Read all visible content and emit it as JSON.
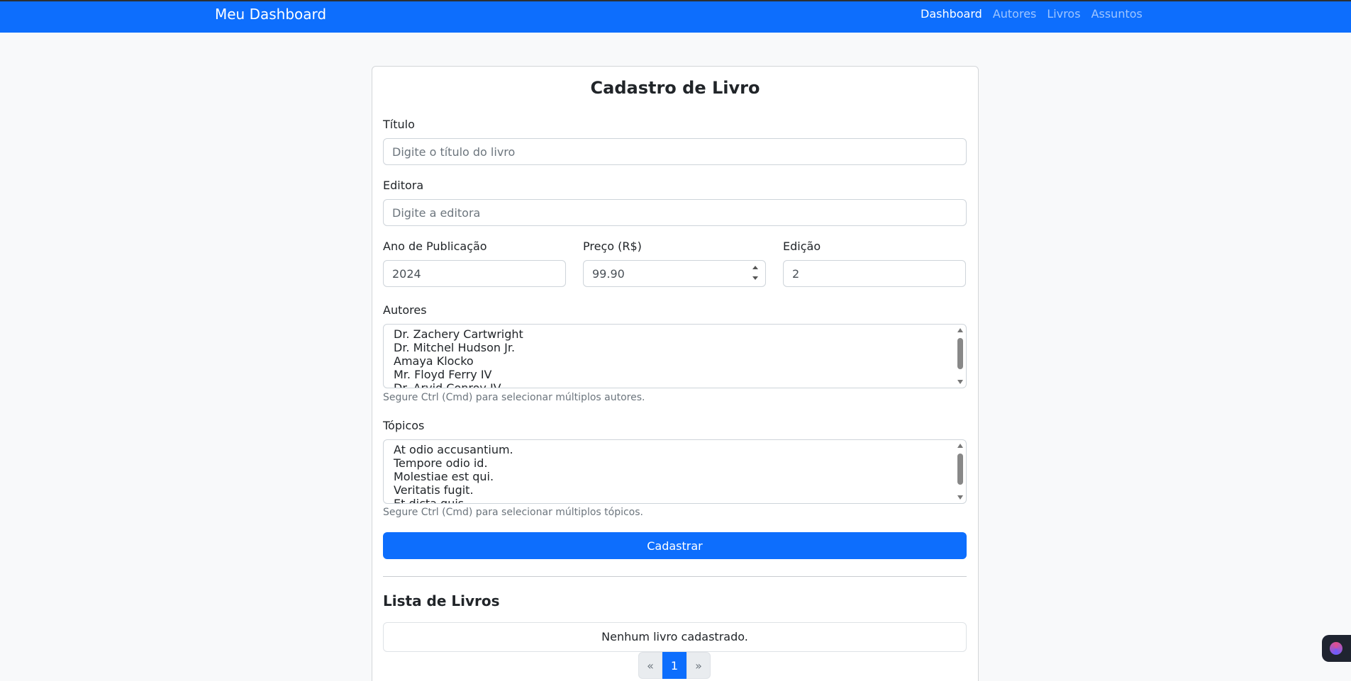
{
  "navbar": {
    "brand": "Meu Dashboard",
    "links": [
      {
        "label": "Dashboard",
        "active": true
      },
      {
        "label": "Autores",
        "active": false
      },
      {
        "label": "Livros",
        "active": false
      },
      {
        "label": "Assuntos",
        "active": false
      }
    ]
  },
  "form": {
    "title": "Cadastro de Livro",
    "titulo": {
      "label": "Título",
      "placeholder": "Digite o título do livro"
    },
    "editora": {
      "label": "Editora",
      "placeholder": "Digite a editora"
    },
    "ano": {
      "label": "Ano de Publicação",
      "value": "2024"
    },
    "preco": {
      "label": "Preço (R$)",
      "value": "99.90"
    },
    "edicao": {
      "label": "Edição",
      "value": "2"
    },
    "autores": {
      "label": "Autores",
      "options": [
        "Dr. Zachery Cartwright",
        "Dr. Mitchel Hudson Jr.",
        "Amaya Klocko",
        "Mr. Floyd Ferry IV",
        "Dr. Arvid Conroy IV"
      ],
      "help": "Segure Ctrl (Cmd) para selecionar múltiplos autores."
    },
    "topicos": {
      "label": "Tópicos",
      "options": [
        "At odio accusantium.",
        "Tempore odio id.",
        "Molestiae est qui.",
        "Veritatis fugit.",
        "Et dicta quis."
      ],
      "help": "Segure Ctrl (Cmd) para selecionar múltiplos tópicos."
    },
    "submit_label": "Cadastrar"
  },
  "list": {
    "title": "Lista de Livros",
    "empty_message": "Nenhum livro cadastrado."
  },
  "pagination": {
    "prev": "«",
    "current": "1",
    "next": "»"
  }
}
